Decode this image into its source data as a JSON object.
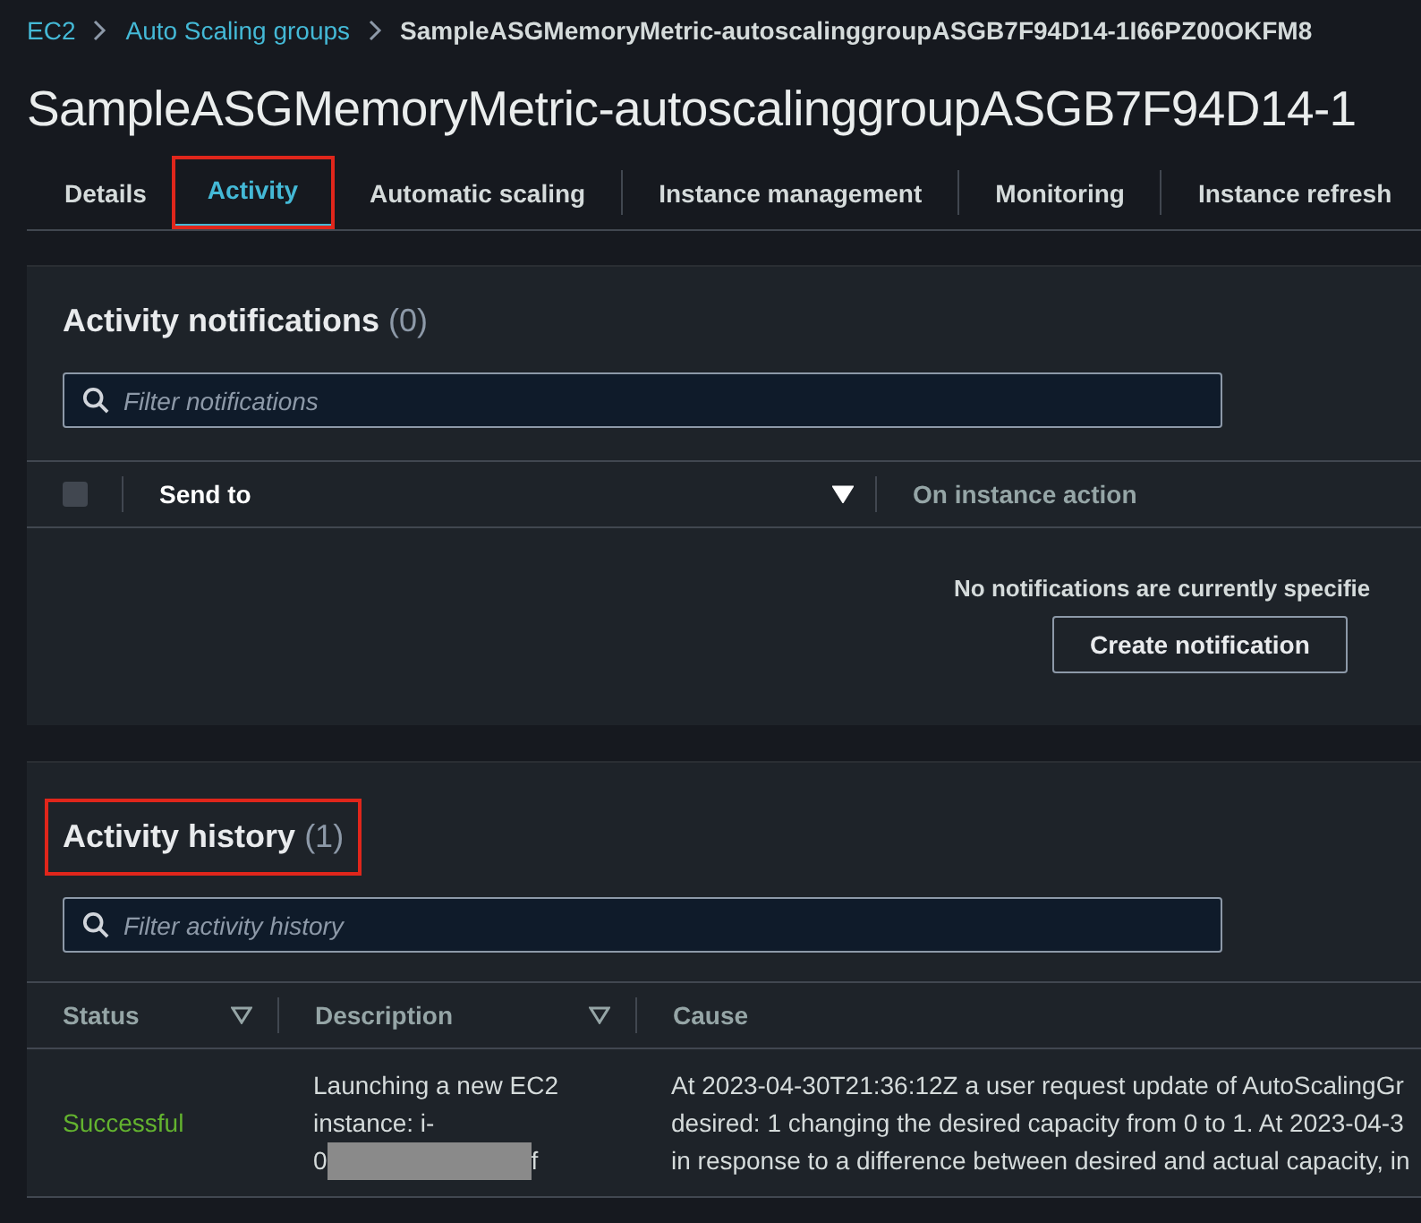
{
  "breadcrumbs": [
    {
      "label": "EC2",
      "link": true
    },
    {
      "label": "Auto Scaling groups",
      "link": true
    },
    {
      "label": "SampleASGMemoryMetric-autoscalinggroupASGB7F94D14-1I66PZ00OKFM8",
      "link": false
    }
  ],
  "title": "SampleASGMemoryMetric-autoscalinggroupASGB7F94D14-1",
  "tabs": [
    {
      "label": "Details",
      "selected": false,
      "highlighted": false
    },
    {
      "label": "Activity",
      "selected": true,
      "highlighted": true
    },
    {
      "label": "Automatic scaling",
      "selected": false,
      "highlighted": false
    },
    {
      "label": "Instance management",
      "selected": false,
      "highlighted": false
    },
    {
      "label": "Monitoring",
      "selected": false,
      "highlighted": false
    },
    {
      "label": "Instance refresh",
      "selected": false,
      "highlighted": false
    }
  ],
  "notifications": {
    "heading": "Activity notifications",
    "count": "(0)",
    "highlighted": false,
    "filter": {
      "placeholder": "Filter notifications"
    },
    "select_all": {
      "checked": false
    },
    "columns": [
      "Send to",
      "On instance action"
    ],
    "empty_message": "No notifications are currently specifie",
    "button": "Create notification"
  },
  "history": {
    "heading": "Activity history",
    "count": "(1)",
    "highlighted": true,
    "filter": {
      "placeholder": "Filter activity history"
    },
    "columns": [
      "Status",
      "Description",
      "Cause"
    ],
    "rows": [
      {
        "status": "Successful",
        "description_lines": [
          "Launching a new EC2",
          "instance: i-"
        ],
        "description_start": "0",
        "description_end": "f",
        "cause_lines": [
          "At 2023-04-30T21:36:12Z a user request update of AutoScalingGr",
          "desired: 1 changing the desired capacity from 0 to 1. At 2023-04-3",
          "in response to a difference between desired and actual capacity, in"
        ]
      }
    ]
  }
}
